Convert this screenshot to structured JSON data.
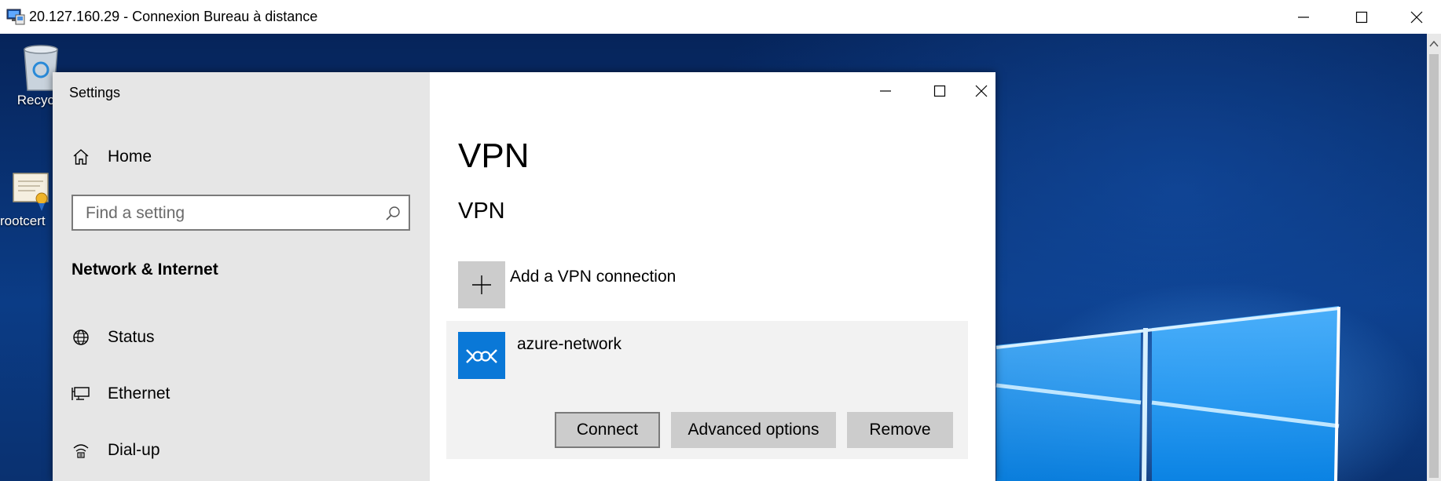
{
  "rdp": {
    "title": "20.127.160.29 - Connexion Bureau à distance"
  },
  "desktop": {
    "icons": [
      {
        "label": "Recycle"
      },
      {
        "label": "rootcert"
      }
    ]
  },
  "settings": {
    "window_title": "Settings",
    "nav": {
      "home_label": "Home",
      "search_placeholder": "Find a setting",
      "section_title": "Network & Internet",
      "items": [
        {
          "label": "Status",
          "icon": "globe-icon"
        },
        {
          "label": "Ethernet",
          "icon": "ethernet-icon"
        },
        {
          "label": "Dial-up",
          "icon": "dialup-icon"
        }
      ]
    },
    "main": {
      "page_title": "VPN",
      "section_title": "VPN",
      "add_connection_label": "Add a VPN connection",
      "connection": {
        "name": "azure-network",
        "buttons": {
          "connect": "Connect",
          "advanced": "Advanced options",
          "remove": "Remove"
        }
      }
    }
  },
  "colors": {
    "accent": "#0a78d7",
    "nav_bg": "#e6e6e6",
    "button_bg": "#cccccc"
  }
}
